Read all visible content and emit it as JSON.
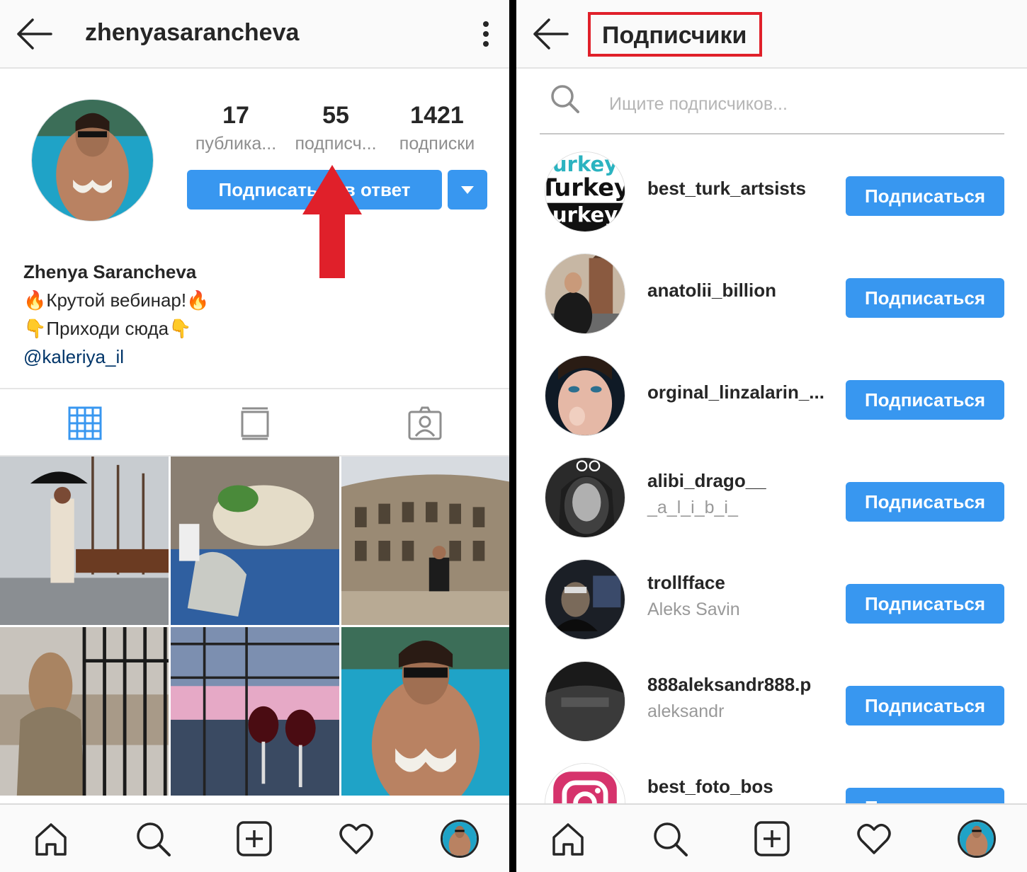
{
  "left": {
    "header": {
      "username": "zhenyasarancheva"
    },
    "stats": [
      {
        "value": "17",
        "label": "публика..."
      },
      {
        "value": "55",
        "label": "подписч..."
      },
      {
        "value": "1421",
        "label": "подписки"
      }
    ],
    "follow_back_label": "Подписаться в ответ",
    "bio": {
      "name": "Zhenya Sarancheva",
      "line1": "🔥Крутой вебинар!🔥",
      "line2": "👇Приходи сюда👇",
      "link": "@kaleriya_il"
    }
  },
  "right": {
    "header": {
      "title": "Подписчики"
    },
    "search": {
      "placeholder": "Ищите подписчиков..."
    },
    "followers": [
      {
        "username": "best_turk_artsists",
        "full_name": "",
        "button": "Подписаться"
      },
      {
        "username": "anatolii_billion",
        "full_name": "",
        "button": "Подписаться"
      },
      {
        "username": "orginal_linzalarin_...",
        "full_name": "",
        "button": "Подписаться"
      },
      {
        "username": "alibi_drago__",
        "full_name": "_a_l_i_b_i_",
        "button": "Подписаться"
      },
      {
        "username": "trollfface",
        "full_name": "Aleks Savin",
        "button": "Подписаться"
      },
      {
        "username": "888aleksandr888.p",
        "full_name": "aleksandr",
        "button": "Подписаться"
      },
      {
        "username": "best_foto_bos",
        "full_name": "",
        "button": "Подписаться"
      }
    ]
  },
  "icons": {
    "back": "arrow-left-icon",
    "more": "more-vertical-icon",
    "grid": "grid-icon",
    "feed": "feed-icon",
    "tagged": "tagged-icon",
    "home": "home-icon",
    "search": "search-icon",
    "add": "add-post-icon",
    "activity": "heart-icon",
    "profile": "profile-avatar"
  },
  "colors": {
    "accent": "#3897f0",
    "highlight_box": "#e0202a",
    "arrow": "#e0202a",
    "text": "#262626",
    "secondary_text": "#8e8e8e"
  }
}
